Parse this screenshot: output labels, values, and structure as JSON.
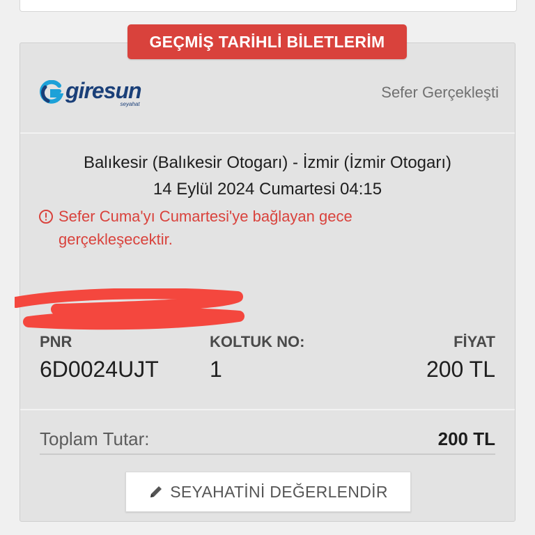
{
  "section": {
    "title": "GEÇMİŞ TARİHLİ BİLETLERİM"
  },
  "ticket": {
    "brand": {
      "name": "giresun",
      "sub": "seyahat"
    },
    "status": "Sefer Gerçekleşti",
    "route": "Balıkesir (Balıkesir Otogarı) - İzmir (İzmir Otogarı)",
    "datetime": "14 Eylül 2024 Cumartesi 04:15",
    "warning": "Sefer Cuma'yı Cumartesi'ye bağlayan gece gerçekleşecektir.",
    "pnr_label": "PNR",
    "pnr": "6D0024UJT",
    "seat_label": "KOLTUK NO:",
    "seat": "1",
    "price_label": "FİYAT",
    "price": "200 TL",
    "total_label": "Toplam Tutar:",
    "total": "200 TL",
    "rate_button": "SEYAHATİNİ DEĞERLENDİR"
  },
  "colors": {
    "accent_red": "#d9423c",
    "brand_navy": "#1a3f78",
    "brand_cyan": "#1da1d8",
    "card_bg": "#e3e3e3"
  },
  "icons": {
    "warning": "info-circle-icon",
    "rate": "pencil-icon",
    "brand": "giresun-logo-icon"
  }
}
